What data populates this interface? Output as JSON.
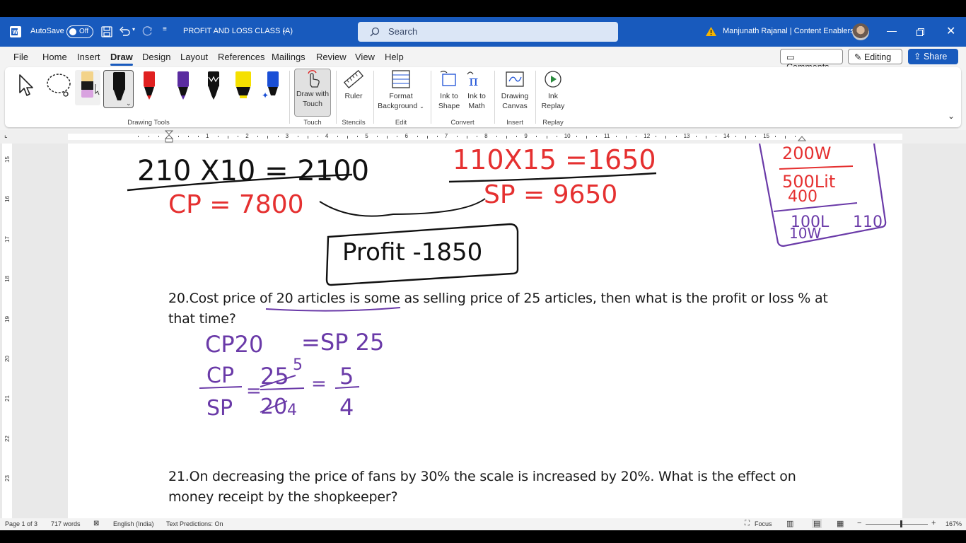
{
  "titlebar": {
    "autosave_label": "AutoSave",
    "autosave_state": "Off",
    "doc_title": "PROFIT AND LOSS CLASS (A)",
    "search_placeholder": "Search",
    "user_name": "Manjunath Rajanal | Content Enablers"
  },
  "menu": {
    "tabs": [
      "File",
      "Home",
      "Insert",
      "Draw",
      "Design",
      "Layout",
      "References",
      "Mailings",
      "Review",
      "View",
      "Help"
    ],
    "active_tab": "Draw",
    "comments_label": "Comments",
    "editing_label": "Editing",
    "share_label": "Share"
  },
  "ribbon": {
    "groups": [
      "Drawing Tools",
      "Touch",
      "Stencils",
      "Edit",
      "Convert",
      "Insert",
      "Replay"
    ],
    "draw_with_touch": [
      "Draw with",
      "Touch"
    ],
    "ruler": "Ruler",
    "format_background": [
      "Format",
      "Background"
    ],
    "ink_to_shape": [
      "Ink to",
      "Shape"
    ],
    "ink_to_math": [
      "Ink to",
      "Math"
    ],
    "drawing_canvas": [
      "Drawing",
      "Canvas"
    ],
    "ink_replay": [
      "Ink",
      "Replay"
    ],
    "pen_colors": [
      "#111111",
      "#e02020",
      "#5a2ca0",
      "#111111",
      "#f5e000",
      "#1a4fd6"
    ]
  },
  "ruler": {
    "numbers": [
      "1",
      "2",
      "3",
      "4",
      "5",
      "6",
      "7",
      "8",
      "9",
      "10",
      "11",
      "12",
      "13",
      "14",
      "15"
    ],
    "v_numbers": [
      "15",
      "16",
      "17",
      "18",
      "19",
      "20",
      "21",
      "22",
      "23"
    ]
  },
  "document": {
    "q20_line1": "20.Cost price of 20 articles is some as selling price of 25 articles, then what is the profit or loss % at",
    "q20_line2": "that time?",
    "q21_line1": "21.On decreasing the price of fans by 30% the scale is increased by 20%. What is the effect on",
    "q21_line2": "money receipt by the shopkeeper?",
    "ink": {
      "line1_left": "210 X10 = 2100",
      "cp": "CP = 7800",
      "line1_right": "110X15 =1650",
      "sp": "SP = 9650",
      "profit": "Profit -1850",
      "box_l1": "200W",
      "box_l2": "500Lit",
      "box_l3": "400",
      "box_l4": "100L",
      "box_l5": "10W",
      "box_l6": "110",
      "cp20": "CP20",
      "sp25": "=SP 25",
      "frac_num": "CP",
      "frac_den": "SP",
      "frac2_num": "25",
      "frac2_den": "20",
      "frac2_small_num": "5",
      "frac2_small_den": "4",
      "frac3_num": "5",
      "frac3_den": "4"
    },
    "ink_colors": {
      "black": "#111111",
      "red": "#e53030",
      "purple": "#6a3aa8"
    }
  },
  "status": {
    "page": "Page 1 of 3",
    "words": "717 words",
    "language": "English (India)",
    "text_predictions": "Text Predictions: On",
    "focus": "Focus",
    "zoom": "167%"
  }
}
